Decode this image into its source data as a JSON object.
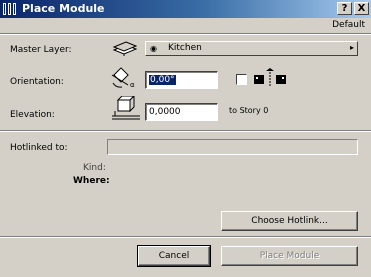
{
  "window": {
    "title": "Place Module",
    "help_label": "?",
    "close_label": "X",
    "default_label": "Default"
  },
  "master_layer": {
    "label": "Master Layer:",
    "value": "Kitchen",
    "arrow": "▸"
  },
  "orientation": {
    "label": "Orientation:",
    "value": "0,00°"
  },
  "elevation": {
    "label": "Elevation:",
    "value": "0,0000",
    "suffix": "to Story 0"
  },
  "hotlink": {
    "label": "Hotlinked to:",
    "value": "",
    "kind_label": "Kind:",
    "where_label": "Where:",
    "choose_label": "Choose Hotlink..."
  },
  "buttons": {
    "cancel": "Cancel",
    "place": "Place Module"
  },
  "colors": {
    "titlebar_start": "#0a246a",
    "titlebar_end": "#a6caf0",
    "face": "#d4d0c8"
  },
  "icons": {
    "app": "module-app-icon",
    "layer": "layer-stack-icon",
    "orientation": "rotation-icon",
    "elevation": "elevation-box-icon",
    "mirror": "mirror-icon"
  }
}
